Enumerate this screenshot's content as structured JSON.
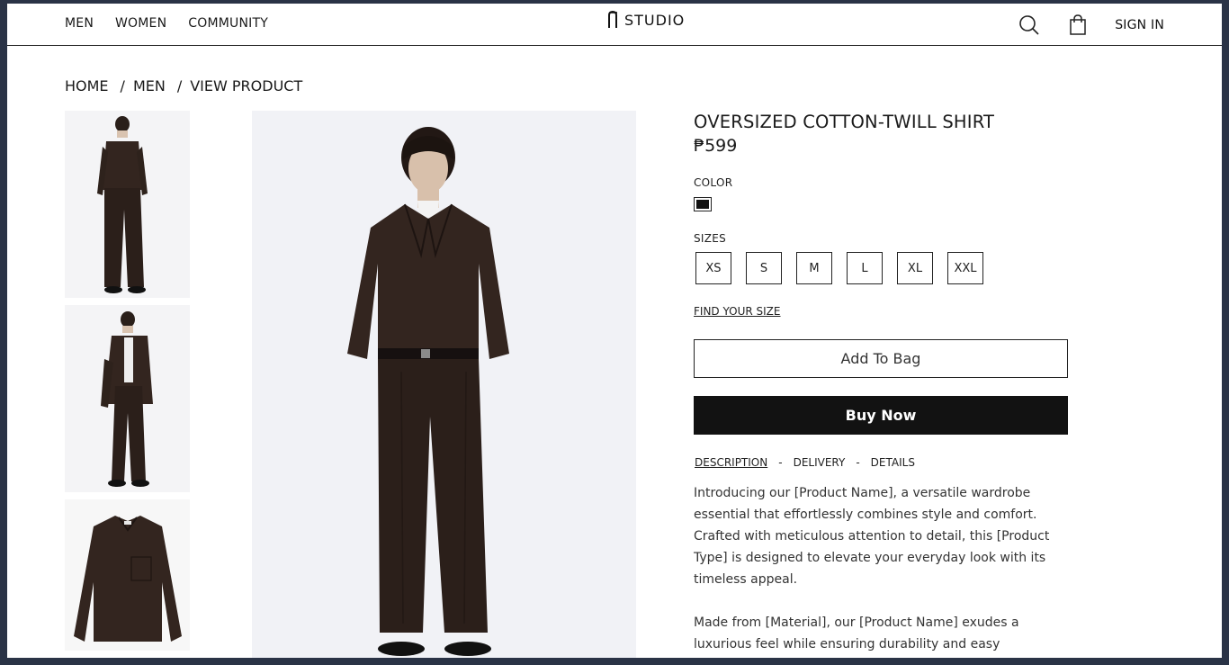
{
  "header": {
    "nav": [
      "MEN",
      "WOMEN",
      "COMMUNITY"
    ],
    "logo_text": "STUDIO",
    "sign_in": "SIGN IN"
  },
  "breadcrumb": {
    "home": "HOME",
    "men": "MEN",
    "current": "VIEW PRODUCT",
    "separator": "/"
  },
  "product": {
    "title": "OVERSIZED COTTON-TWILL SHIRT",
    "price": "₱599",
    "color_label": "COLOR",
    "color_value": "#111111",
    "sizes_label": "SIZES",
    "sizes": [
      "XS",
      "S",
      "M",
      "L",
      "XL",
      "XXL"
    ],
    "find_size": "FIND YOUR SIZE",
    "add_to_bag": "Add To Bag",
    "buy_now": "Buy Now"
  },
  "tabs": {
    "description": "DESCRIPTION",
    "delivery": "DELIVERY",
    "details": "DETAILS",
    "separator": "-"
  },
  "description": {
    "p1": "Introducing our [Product Name], a versatile wardrobe essential that effortlessly combines style and comfort. Crafted with meticulous attention to detail, this [Product Type] is designed to elevate your everyday look with its timeless appeal.",
    "p2": "Made from [Material], our [Product Name] exudes a luxurious feel while ensuring durability and easy maintenance. The"
  },
  "colors": {
    "accent": "#121212",
    "background": "#ffffff",
    "window_bg": "#2a3346"
  }
}
